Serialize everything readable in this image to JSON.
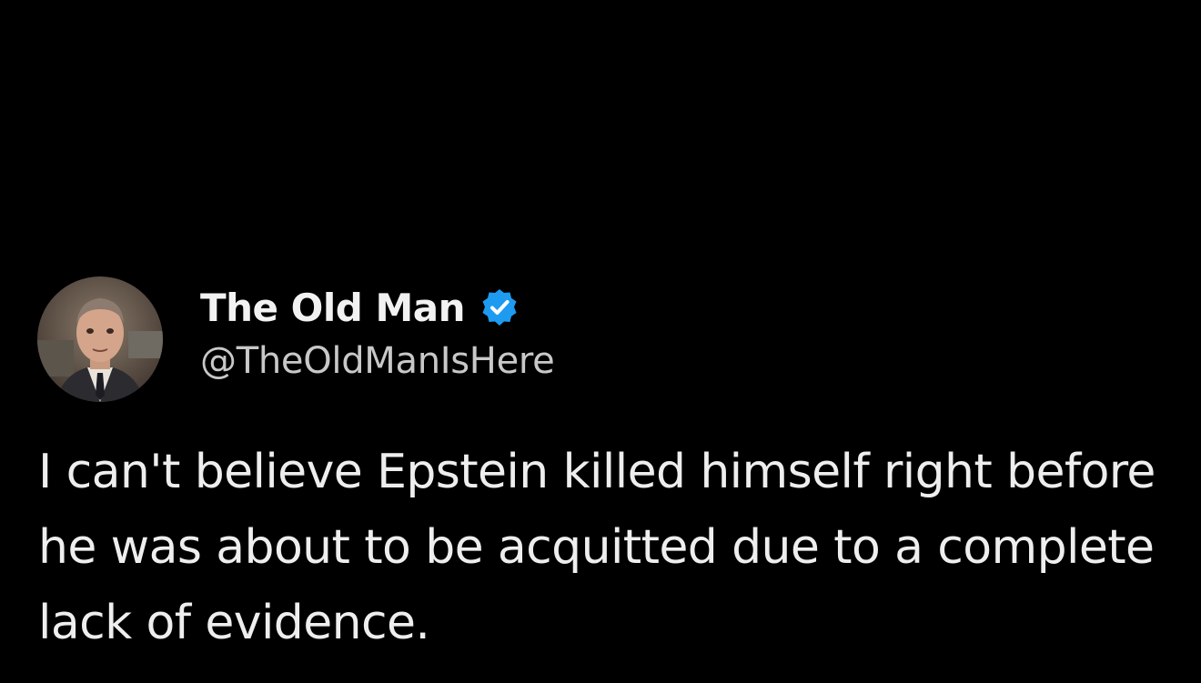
{
  "tweet": {
    "author": {
      "display_name": "The Old Man",
      "handle": "@TheOldManIsHere",
      "verified": true,
      "avatar_icon": "profile-photo"
    },
    "text": "I can't believe Epstein killed himself right before he was about to be acquitted due to a complete lack of evidence."
  },
  "colors": {
    "background": "#000000",
    "text": "#e7e9ea",
    "handle": "#c8c8c8",
    "verified_badge": "#1d9bf0"
  }
}
